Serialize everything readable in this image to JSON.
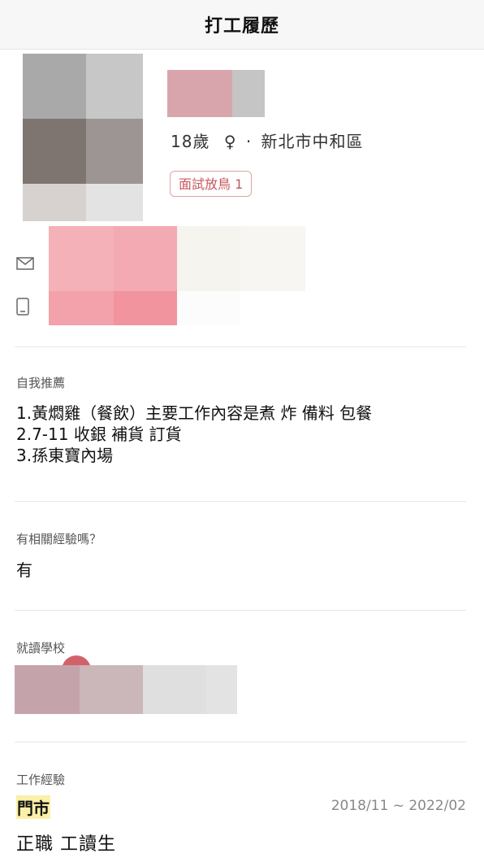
{
  "header": {
    "title": "打工履歷"
  },
  "profile": {
    "age": "18歲",
    "gender_symbol": "♀",
    "separator": "·",
    "location": "新北市中和區",
    "no_show_badge": "面試放鳥 1"
  },
  "contact": {
    "email_icon": "mail-icon",
    "phone_icon": "mobile-phone-icon"
  },
  "self_intro": {
    "label": "自我推薦",
    "lines": [
      "1.黃燜雞（餐飲）主要工作內容是煮 炸 備料 包餐",
      "2.7-11 收銀 補貨 訂貨",
      "3.孫東寶內場"
    ]
  },
  "experience_question": {
    "label": "有相關經驗嗎？",
    "answer": "有"
  },
  "school": {
    "label": "就讀學校"
  },
  "work_experience": {
    "label": "工作經驗",
    "title": "門市",
    "dates": "2018/11 ~ 2022/02",
    "employment_type": "正職 工讀生"
  },
  "colors": {
    "badge_text": "#c8585d",
    "badge_border": "#e0a3a3",
    "highlight": "#fbf0a8"
  }
}
